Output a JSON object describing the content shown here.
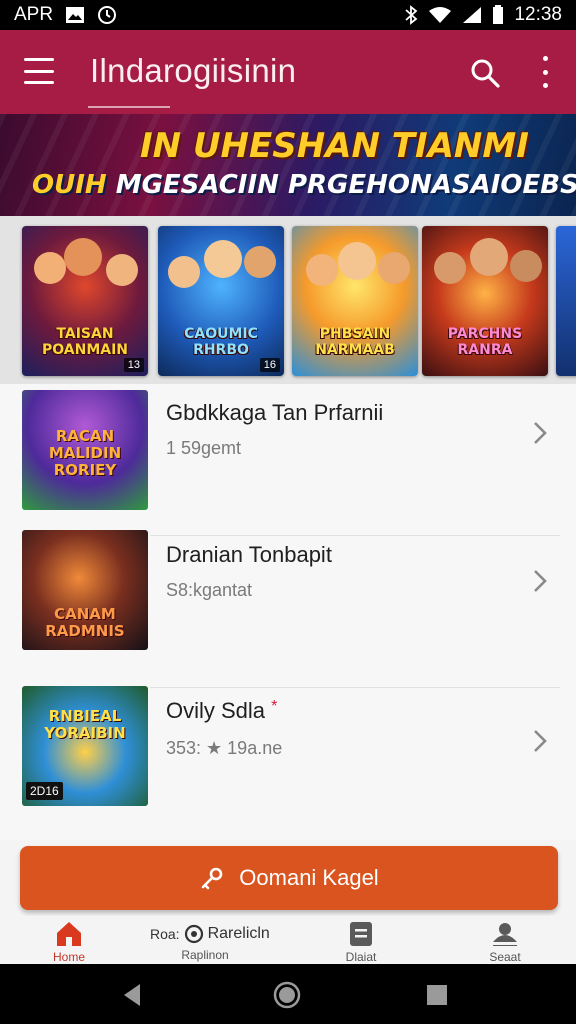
{
  "status_bar": {
    "carrier": "APR",
    "signal_text": "",
    "time": "12:38"
  },
  "app_bar": {
    "title": "Ilndarogiisinin",
    "menu_icon": "menu-icon",
    "search_icon": "search-icon",
    "more_icon": "more-vert-icon"
  },
  "hero": {
    "line1": "IN UHESHAN TIANMI",
    "line2_part1": "OUIH",
    "line2_part2": " MGESACIIN PRGEHONASAIOEBS"
  },
  "carousel": {
    "cards": [
      {
        "title": "TAISAN\nPOANMAIN",
        "badge": "13"
      },
      {
        "title": "CAOUMIC\nRHRBO",
        "badge": "16"
      },
      {
        "title": "PHBSAIN\nNARMAAB",
        "badge": ""
      },
      {
        "title": "PARCHNS\nRANRA",
        "badge": ""
      }
    ]
  },
  "list": {
    "items": [
      {
        "name": "Gbdkkaga Tan Prfarnii",
        "meta": "1 59gemt",
        "thumb_label": "RACAN\nMALIDIN\nRORIEY",
        "thumb_badge": ""
      },
      {
        "name": "Dranian Tonbapit",
        "meta": "S8:kgantat",
        "thumb_label": "CANAM\nRADMNIS",
        "thumb_badge": ""
      },
      {
        "name": "Ovily Sdla",
        "meta": "353: ★ 19a.ne",
        "thumb_label": "RNBIEAL\nYORAIBIN",
        "thumb_badge": "2D16"
      }
    ],
    "starred_mark": "*"
  },
  "cta": {
    "label": "Oomani Kagel",
    "icon": "key-icon"
  },
  "bottom_nav": {
    "items": [
      {
        "label": "Home",
        "icon": "home-icon",
        "active": true
      },
      {
        "label": "Raplinon",
        "icon": "circle-c-icon"
      },
      {
        "label": "Dlaiat",
        "icon": "list-icon"
      },
      {
        "label": "Seaat",
        "icon": "profile-icon"
      }
    ],
    "mid_prefix": "Roa:",
    "mid_label": "Rarelicln"
  },
  "colors": {
    "app_bar": "#a71c45",
    "cta": "#d9541e",
    "active_nav": "#c0392b"
  }
}
